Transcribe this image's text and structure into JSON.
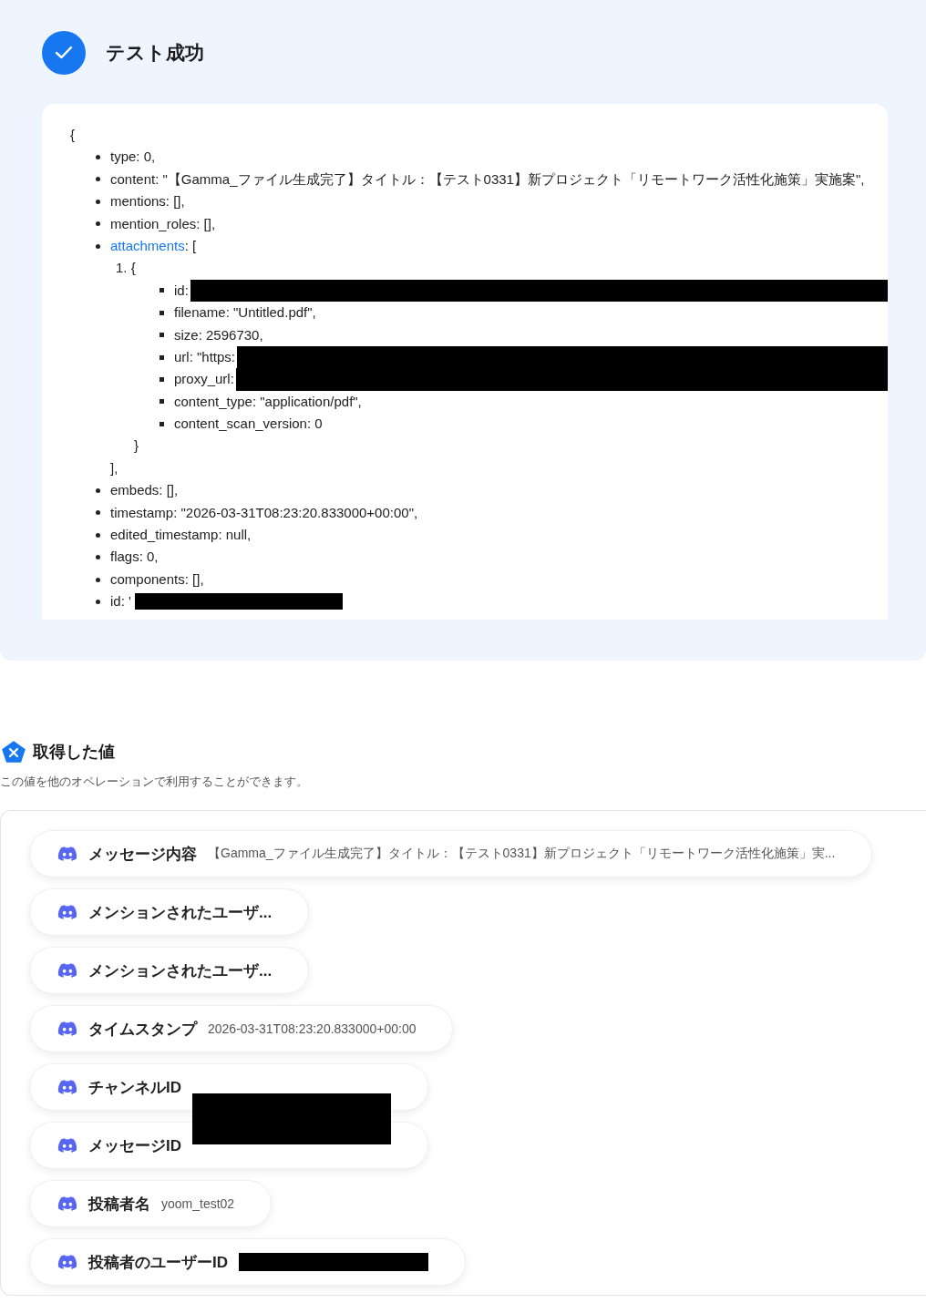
{
  "result": {
    "title": "テスト成功",
    "code": {
      "open": "{",
      "items": [
        {
          "text": "type: 0,"
        },
        {
          "text": "content: \"【Gamma_ファイル生成完了】タイトル：【テスト0331】新プロジェクト「リモートワーク活性化施策」実施案\","
        },
        {
          "text": "mentions: [],"
        },
        {
          "text": "mention_roles: [],"
        },
        {
          "link": "attachments",
          "text": ": [",
          "close": "],",
          "children": [
            {
              "marker": "1.",
              "open": "{",
              "close": "}",
              "items": [
                {
                  "text": "id:",
                  "redacted": true
                },
                {
                  "text": "filename: \"Untitled.pdf\","
                },
                {
                  "text": "size: 2596730,"
                },
                {
                  "text": "url: \"https:",
                  "redacted": true
                },
                {
                  "text": "proxy_url:",
                  "redacted": true
                },
                {
                  "text": "content_type: \"application/pdf\","
                },
                {
                  "text": "content_scan_version: 0"
                }
              ]
            }
          ]
        },
        {
          "text": "embeds: [],"
        },
        {
          "text": "timestamp: \"2026-03-31T08:23:20.833000+00:00\","
        },
        {
          "text": "edited_timestamp: null,"
        },
        {
          "text": "flags: 0,"
        },
        {
          "text": "components: [],"
        },
        {
          "text": "id: '",
          "redacted": true
        }
      ]
    }
  },
  "values": {
    "title": "取得した値",
    "description": "この値を他のオペレーションで利用することができます。",
    "items": [
      {
        "label": "メッセージ内容",
        "value": "【Gamma_ファイル生成完了】タイトル：【テスト0331】新プロジェクト「リモートワーク活性化施策」実..."
      },
      {
        "label": "メンションされたユーザ..."
      },
      {
        "label": "メンションされたユーザ..."
      },
      {
        "label": "タイムスタンプ",
        "value": "2026-03-31T08:23:20.833000+00:00"
      },
      {
        "label": "チャンネルID",
        "redacted": true
      },
      {
        "label": "メッセージID",
        "redacted": true
      },
      {
        "label": "投稿者名",
        "value": "yoom_test02"
      },
      {
        "label": "投稿者のユーザーID",
        "redacted": true
      }
    ]
  }
}
